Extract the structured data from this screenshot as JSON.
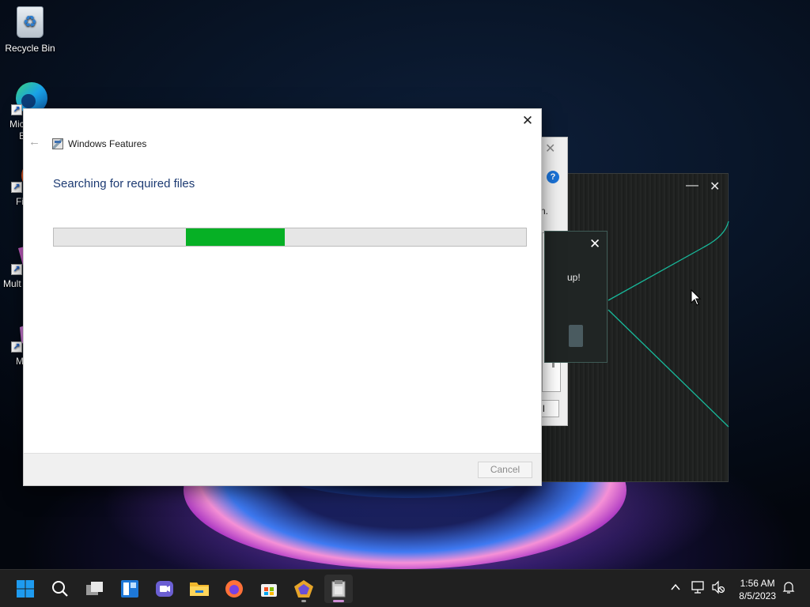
{
  "desktop": {
    "icons": [
      {
        "label": "Recycle Bin"
      },
      {
        "label": "Mic"
      },
      {
        "label": "E"
      },
      {
        "label": "Fi"
      },
      {
        "label": "Mult"
      },
      {
        "label": "M"
      }
    ]
  },
  "main_dialog": {
    "title": "Windows Features",
    "heading": "Searching for required files",
    "progress": {
      "indeterminate": true,
      "segment_start": 0.28,
      "segment_end": 0.49,
      "color": "#06b025"
    },
    "close_symbol": "✕",
    "back_symbol": "←",
    "cancel_label": "Cancel"
  },
  "background_dialog": {
    "close_symbol": "✕",
    "help_symbol": "?",
    "text_fragment": "n.",
    "button_fragment": "l"
  },
  "popup": {
    "close_symbol": "✕",
    "message_fragment": "up!"
  },
  "dark_window": {
    "minimize_symbol": "—",
    "close_symbol": "✕"
  },
  "taskbar": {
    "apps": [
      {
        "name": "start-button"
      },
      {
        "name": "search-button"
      },
      {
        "name": "task-view-button"
      },
      {
        "name": "widgets-button"
      },
      {
        "name": "teams-chat-button"
      },
      {
        "name": "file-explorer-button"
      },
      {
        "name": "firefox-button"
      },
      {
        "name": "microsoft-store-button"
      },
      {
        "name": "pinned-app-button"
      },
      {
        "name": "windows-features-button"
      }
    ],
    "tray": {
      "chevron": "^",
      "time": "1:56 AM",
      "date": "8/5/2023"
    }
  },
  "colors": {
    "accent": "#0067c0",
    "progress_green": "#06b025",
    "heading_blue": "#1c3a72",
    "taskbar": "#202020"
  }
}
